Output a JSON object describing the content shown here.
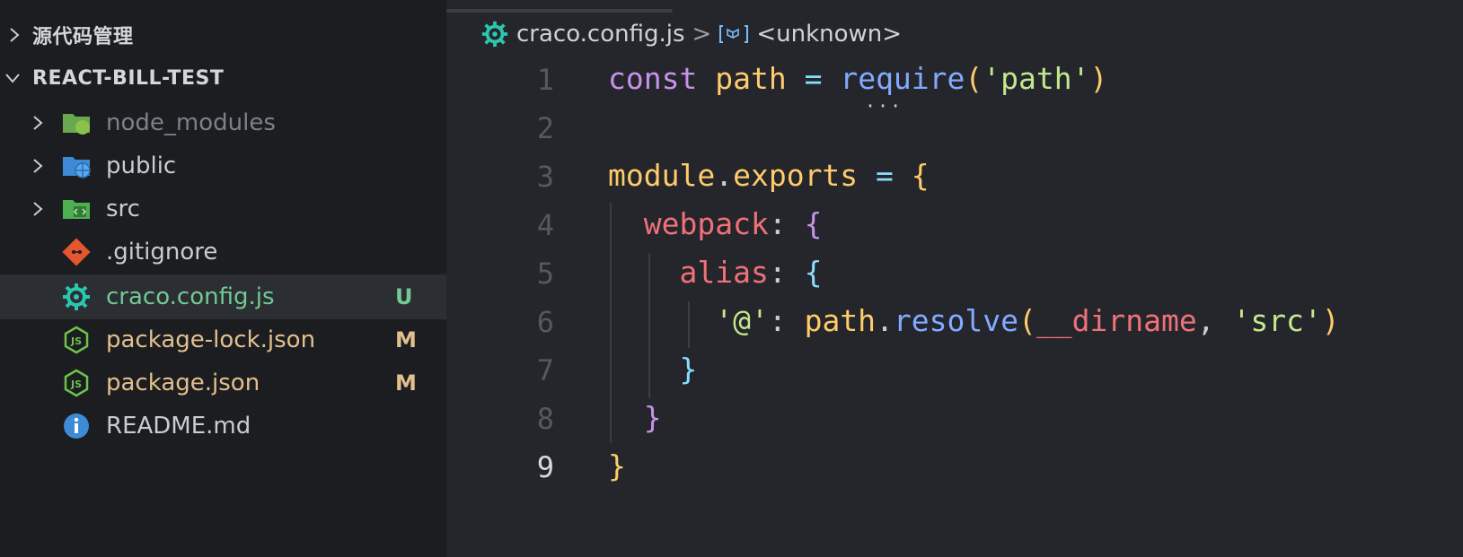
{
  "explorer": {
    "section_source_control": "源代码管理",
    "section_project": "REACT-BILL-TEST",
    "items": [
      {
        "name": "node_modules",
        "status": "",
        "color": "#7c8088"
      },
      {
        "name": "public",
        "status": "",
        "color": "#c9ccd1"
      },
      {
        "name": "src",
        "status": "",
        "color": "#c9ccd1"
      },
      {
        "name": ".gitignore",
        "status": "",
        "color": "#c9ccd1"
      },
      {
        "name": "craco.config.js",
        "status": "U",
        "color": "#73c991"
      },
      {
        "name": "package-lock.json",
        "status": "M",
        "color": "#e2c08d"
      },
      {
        "name": "package.json",
        "status": "M",
        "color": "#e2c08d"
      },
      {
        "name": "README.md",
        "status": "",
        "color": "#c9ccd1"
      }
    ]
  },
  "breadcrumb": {
    "file": "craco.config.js",
    "separator": ">",
    "symbol": "<unknown>"
  },
  "editor": {
    "active_line": 9,
    "line_numbers": [
      "1",
      "2",
      "3",
      "4",
      "5",
      "6",
      "7",
      "8",
      "9"
    ],
    "lines": {
      "l1": {
        "kw": "const",
        "var": "path",
        "op": "=",
        "fn": "require",
        "open": "(",
        "str": "'path'",
        "close": ")"
      },
      "l3": {
        "a": "module",
        "dot": ".",
        "b": "exports",
        "op": "=",
        "brace": "{"
      },
      "l4": {
        "prop": "webpack",
        "colon": ":",
        "brace": "{"
      },
      "l5": {
        "prop": "alias",
        "colon": ":",
        "brace": "{"
      },
      "l6": {
        "key": "'@'",
        "colon": ":",
        "obj": "path",
        "dot": ".",
        "fn": "resolve",
        "open": "(",
        "param": "__dirname",
        "comma": ",",
        "str": "'src'",
        "close": ")"
      },
      "l7": {
        "brace": "}"
      },
      "l8": {
        "brace": "}"
      },
      "l9": {
        "brace": "}"
      }
    }
  },
  "colors": {
    "accent_green": "#73c991",
    "modified": "#e2c08d",
    "editor_bg": "#24262b",
    "sidebar_bg": "#1c1d20"
  },
  "icons": {
    "gear": "gear-icon",
    "folder": "folder-icon",
    "git": "git-icon",
    "node": "nodejs-icon",
    "info": "info-icon"
  }
}
